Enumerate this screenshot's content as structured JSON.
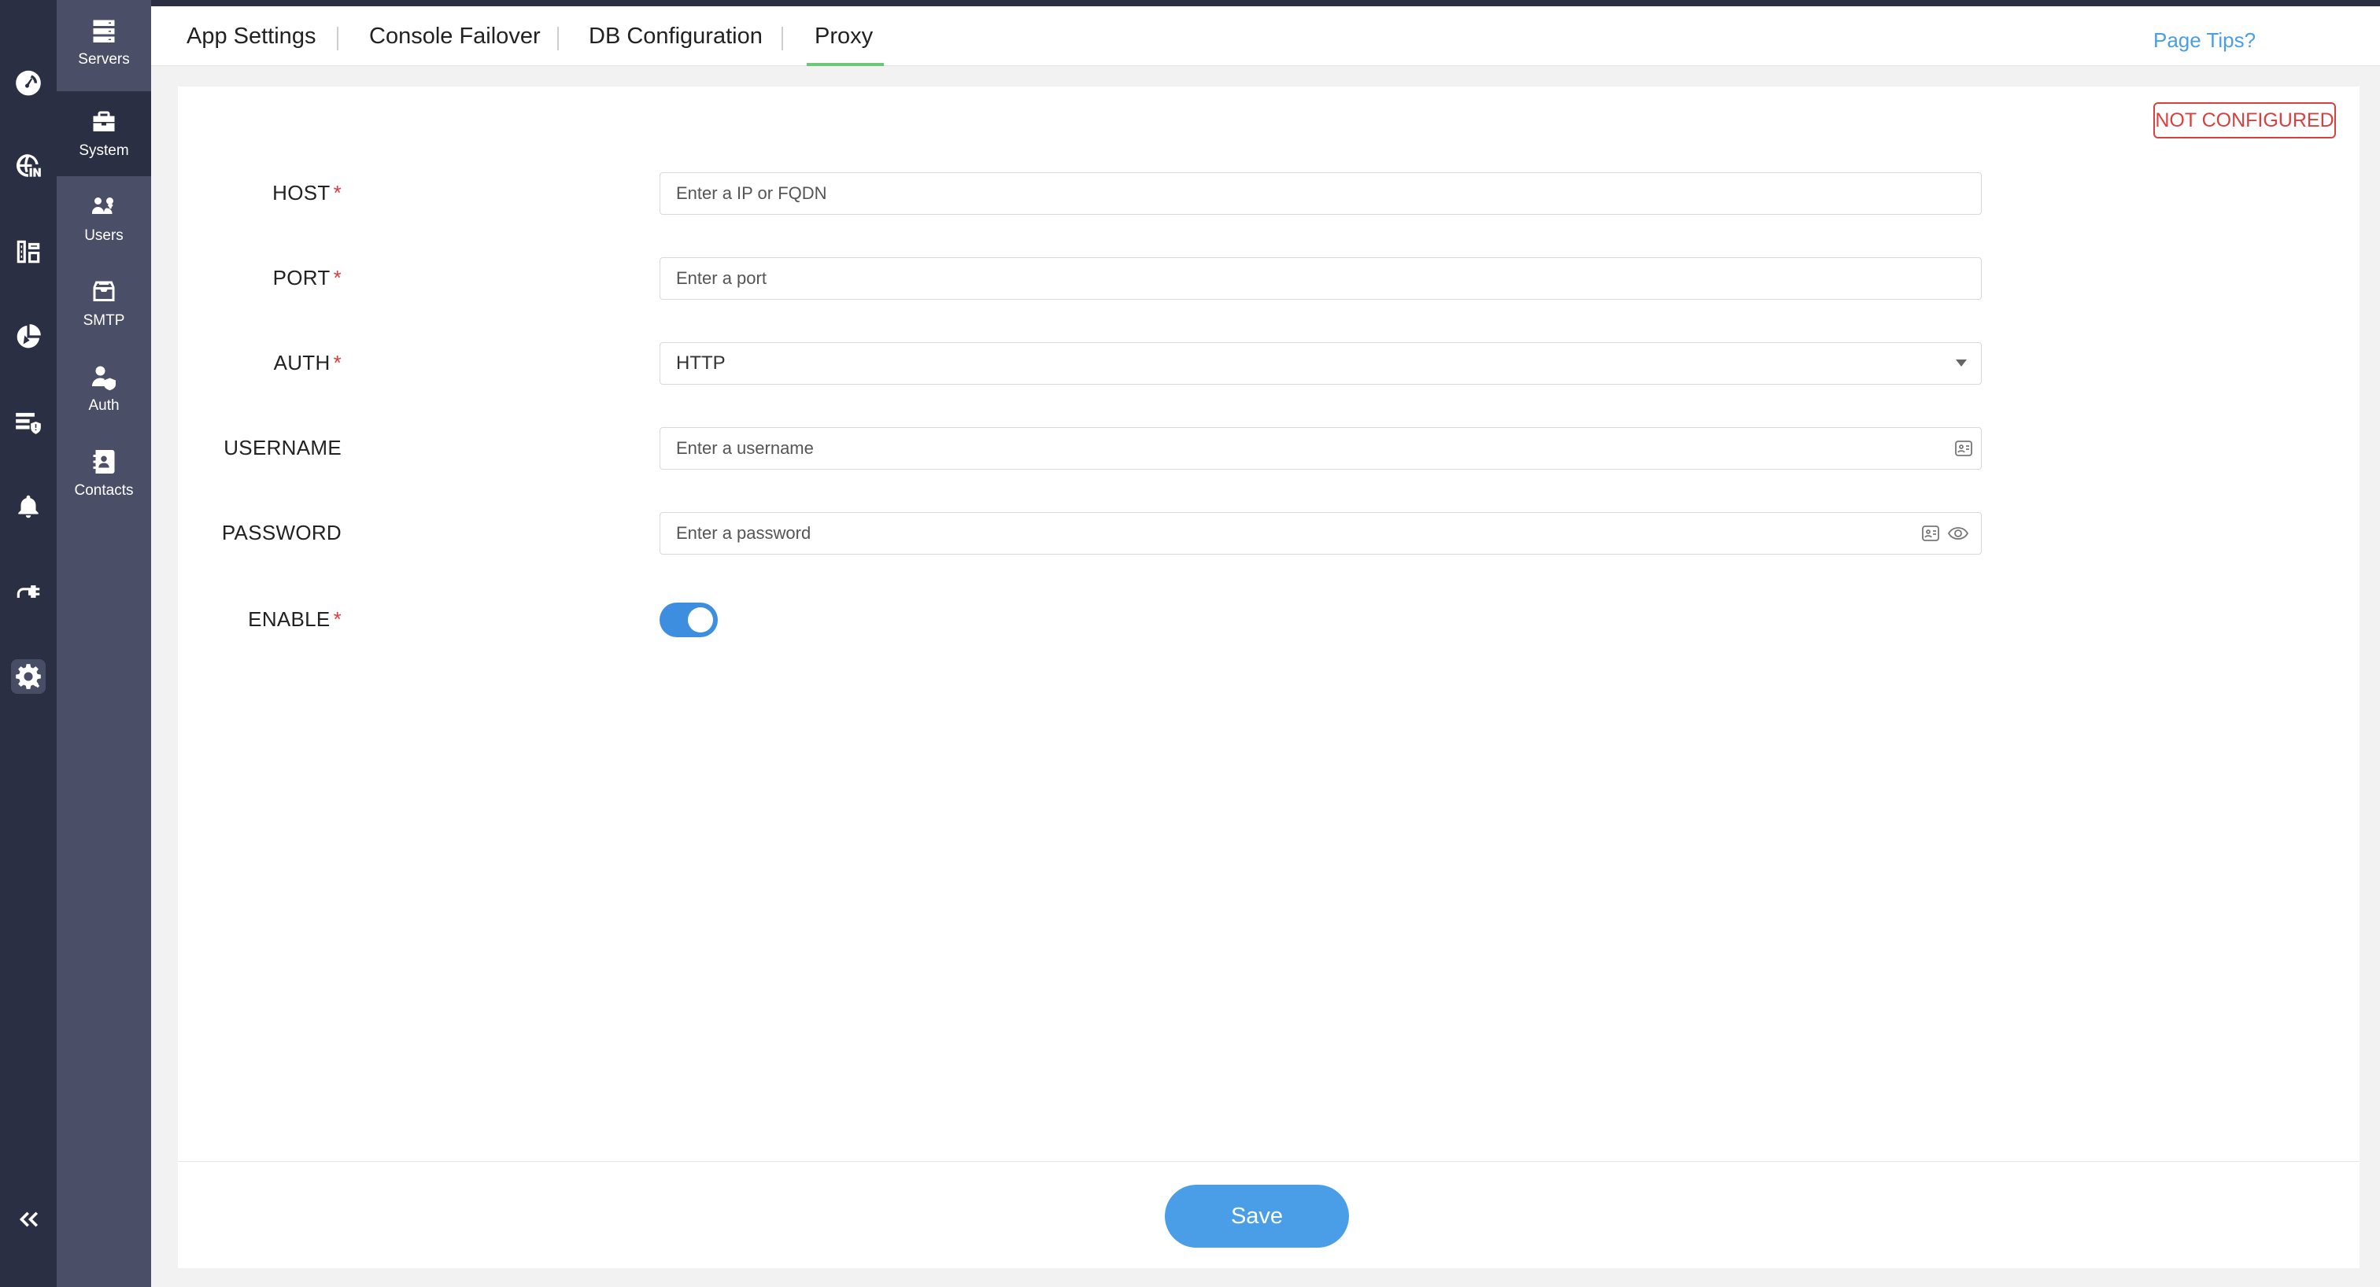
{
  "rail": {
    "items": [
      {
        "icon": "dashboard-gauge-icon"
      },
      {
        "icon": "dns-globe-icon"
      },
      {
        "icon": "inventory-icon"
      },
      {
        "icon": "pie-chart-icon"
      },
      {
        "icon": "security-list-icon"
      },
      {
        "icon": "bell-icon"
      },
      {
        "icon": "plug-icon"
      },
      {
        "icon": "settings-gear-icon"
      }
    ],
    "collapse_icon": "double-chevron-left-icon"
  },
  "subnav": {
    "items": [
      {
        "label": "Servers",
        "icon": "servers-icon"
      },
      {
        "label": "System",
        "icon": "toolbox-icon"
      },
      {
        "label": "Users",
        "icon": "users-icon"
      },
      {
        "label": "SMTP",
        "icon": "mail-inbox-icon"
      },
      {
        "label": "Auth",
        "icon": "user-shield-icon"
      },
      {
        "label": "Contacts",
        "icon": "address-book-icon"
      }
    ],
    "active": "System"
  },
  "tabs": [
    {
      "label": "App Settings"
    },
    {
      "label": "Console Failover"
    },
    {
      "label": "DB Configuration"
    },
    {
      "label": "Proxy"
    }
  ],
  "active_tab": "Proxy",
  "page_tips": "Page Tips?",
  "status_badge": "NOT CONFIGURED",
  "form": {
    "host": {
      "label": "HOST",
      "required": "*",
      "placeholder": "Enter a IP or FQDN"
    },
    "port": {
      "label": "PORT",
      "required": "*",
      "placeholder": "Enter a port"
    },
    "auth": {
      "label": "AUTH",
      "required": "*",
      "value": "HTTP"
    },
    "username": {
      "label": "USERNAME",
      "placeholder": "Enter a username"
    },
    "password": {
      "label": "PASSWORD",
      "placeholder": "Enter a password"
    },
    "enable": {
      "label": "ENABLE",
      "required": "*",
      "on": true
    }
  },
  "save_label": "Save",
  "colors": {
    "rail_bg": "#2b2f44",
    "subnav_bg": "#4a4e66",
    "accent_blue": "#4a9ee8",
    "tab_underline": "#6cc777",
    "badge_red": "#d94040"
  }
}
